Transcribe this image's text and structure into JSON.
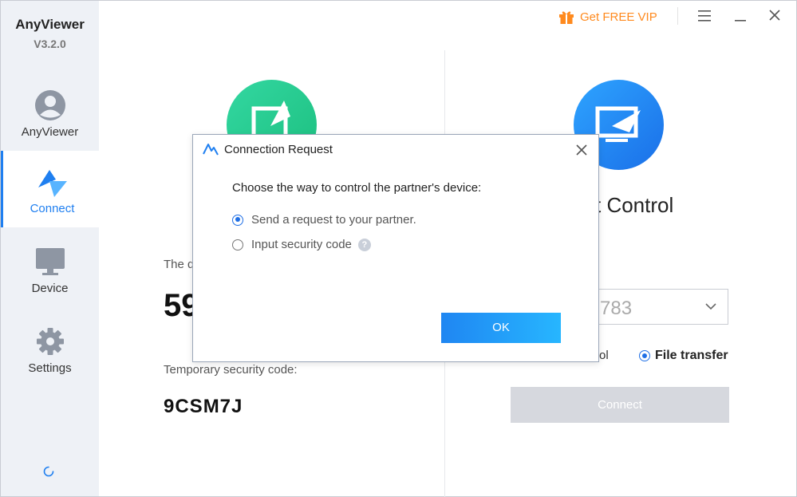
{
  "app": {
    "name": "AnyViewer",
    "version": "V3.2.0"
  },
  "sidebar": {
    "items": [
      {
        "label": "AnyViewer",
        "icon": "user-avatar-icon"
      },
      {
        "label": "Connect",
        "icon": "connect-logo-icon",
        "active": true
      },
      {
        "label": "Device",
        "icon": "monitor-icon"
      },
      {
        "label": "Settings",
        "icon": "gear-icon"
      }
    ]
  },
  "topbar": {
    "vip_label": "Get FREE VIP",
    "vip_color": "#ff8a1e"
  },
  "left_panel": {
    "device_id_label": "The d",
    "device_id": "59",
    "temp_code_label": "Temporary security code:",
    "temp_code": "9CSM7J"
  },
  "right_panel": {
    "title": "t Control",
    "partner_id": "783",
    "mode_remote_partial": "rol",
    "mode_file_transfer": "File transfer",
    "connect_label": "Connect"
  },
  "dialog": {
    "title": "Connection Request",
    "question": "Choose the way to control the partner's device:",
    "options": [
      {
        "label": "Send a request to your partner.",
        "selected": true
      },
      {
        "label": "Input security code",
        "selected": false
      }
    ],
    "help_glyph": "?",
    "ok_label": "OK"
  },
  "colors": {
    "accent": "#1f7ff0",
    "green": "#22c98a",
    "blue": "#1f86f2"
  }
}
